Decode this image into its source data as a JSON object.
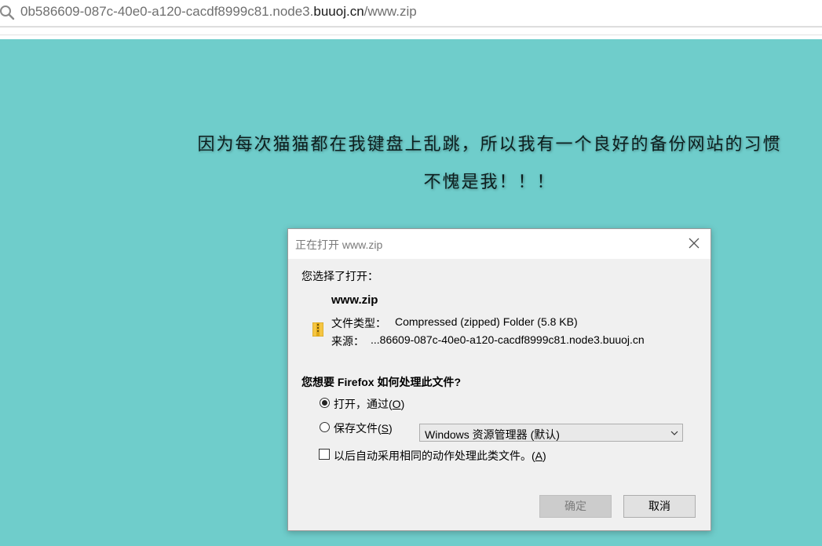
{
  "address_bar": {
    "url_prefix": "0b586609-087c-40e0-a120-cacdf8999c81.node3.",
    "url_domain": "buuoj.cn",
    "url_suffix": "/www.zip"
  },
  "page": {
    "background": "#6fcdcb",
    "headline_line1": "因为每次猫猫都在我键盘上乱跳，所以我有一个良好的备份网站的习惯",
    "headline_line2": "不愧是我！！！"
  },
  "dialog": {
    "title": "正在打开 www.zip",
    "chosen_label": "您选择了打开：",
    "file_name": "www.zip",
    "type_label": "文件类型：",
    "type_value": "Compressed (zipped) Folder (5.8 KB)",
    "source_label": "来源：",
    "source_value": "...86609-087c-40e0-a120-cacdf8999c81.node3.buuoj.cn",
    "question_prefix": "您想要 ",
    "question_app": "Firefox",
    "question_suffix": " 如何处理此文件?",
    "open_with_label": "打开，通过(",
    "open_with_key": "O",
    "open_with_close": ")",
    "open_with_value": "Windows 资源管理器 (默认)",
    "save_label": "保存文件(",
    "save_key": "S",
    "save_close": ")",
    "auto_label": "以后自动采用相同的动作处理此类文件。(",
    "auto_key": "A",
    "auto_close": ")",
    "ok_button": "确定",
    "cancel_button": "取消"
  }
}
